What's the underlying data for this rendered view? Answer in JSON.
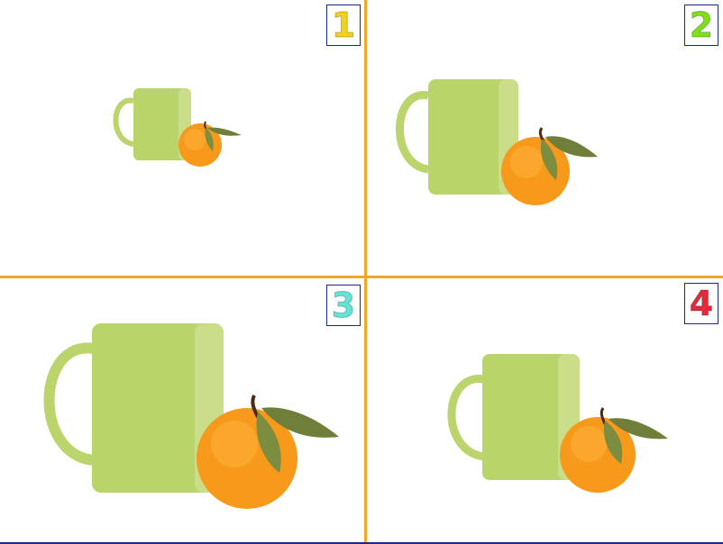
{
  "panels": [
    {
      "id": 1,
      "number": "1",
      "number_color": "#f2d21b",
      "scale": 0.55
    },
    {
      "id": 2,
      "number": "2",
      "number_color": "#7ee01b",
      "scale": 0.8
    },
    {
      "id": 3,
      "number": "3",
      "number_color": "#5fe6d6",
      "scale": 1.15
    },
    {
      "id": 4,
      "number": "4",
      "number_color": "#e8283a",
      "scale": 0.75
    }
  ],
  "colors": {
    "divider": "#f5a623",
    "badge_border": "#1a2a8a",
    "mug": "#b9d468",
    "orange": "#f79a1c",
    "leaf": "#6f7f3a"
  },
  "objects": {
    "mug": "mug-icon",
    "orange": "orange-icon"
  }
}
